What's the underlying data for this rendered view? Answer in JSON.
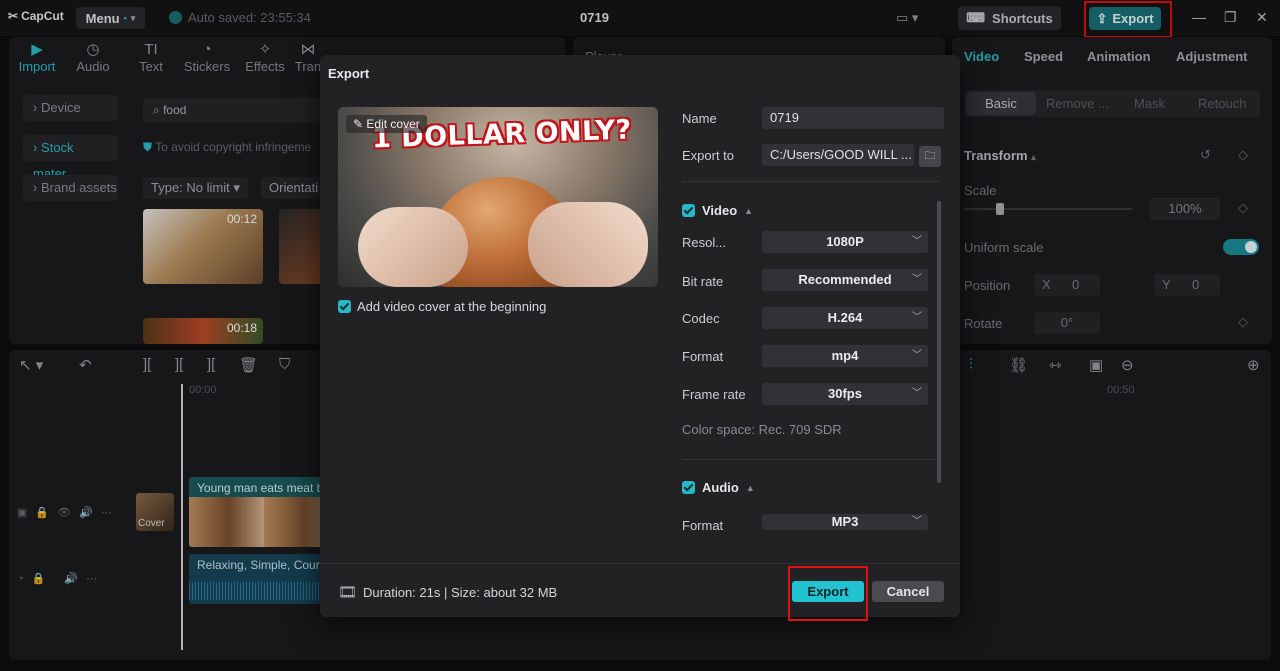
{
  "app": {
    "logo": "CapCut",
    "menu_label": "Menu",
    "autosave": "Auto saved: 23:55:34",
    "project_title": "0719",
    "shortcuts_label": "Shortcuts",
    "export_label": "Export"
  },
  "left_panel": {
    "tools": [
      "Import",
      "Audio",
      "Text",
      "Stickers",
      "Effects",
      "Tran"
    ],
    "side_items": [
      "Device",
      "Stock mater...",
      "Brand assets"
    ],
    "search_value": "food",
    "notice": "To avoid copyright infringeme",
    "filters": [
      "Type: No limit",
      "Orientati"
    ],
    "thumbs": [
      {
        "duration": "00:12"
      },
      {
        "duration": "00:18"
      }
    ]
  },
  "player": {
    "title": "Player"
  },
  "right_panel": {
    "tabs": [
      "Video",
      "Speed",
      "Animation",
      "Adjustment"
    ],
    "subtabs": [
      "Basic",
      "Remove ...",
      "Mask",
      "Retouch"
    ],
    "transform_label": "Transform",
    "scale_label": "Scale",
    "scale_value": "100%",
    "uniform_scale_label": "Uniform scale",
    "position_label": "Position",
    "pos_x_label": "X",
    "pos_x_value": "0",
    "pos_y_label": "Y",
    "pos_y_value": "0",
    "rotate_label": "Rotate",
    "rotate_value": "0°"
  },
  "timeline": {
    "time_start": "00:00",
    "time_mark": "00:50",
    "video_clip": "Young man eats meat bu",
    "audio_clip": "Relaxing, Simple, Country",
    "cover_label": "Cover"
  },
  "dialog": {
    "title": "Export",
    "edit_cover": "Edit cover",
    "cover_text": "1 DOLLAR ONLY?",
    "add_cover_label": "Add video cover at the beginning",
    "name_label": "Name",
    "name_value": "0719",
    "export_to_label": "Export to",
    "export_to_value": "C:/Users/GOOD WILL ...",
    "video_section": "Video",
    "resolution_label": "Resol...",
    "resolution_value": "1080P",
    "bitrate_label": "Bit rate",
    "bitrate_value": "Recommended",
    "codec_label": "Codec",
    "codec_value": "H.264",
    "format_label": "Format",
    "format_value": "mp4",
    "framerate_label": "Frame rate",
    "framerate_value": "30fps",
    "colorspace": "Color space: Rec. 709 SDR",
    "audio_section": "Audio",
    "audio_format_label": "Format",
    "audio_format_value": "MP3",
    "duration_size": "Duration: 21s | Size: about 32 MB",
    "export_button": "Export",
    "cancel_button": "Cancel"
  },
  "colors": {
    "accent": "#22c2d0",
    "highlight": "#e01010",
    "dialog_bg": "#222225"
  }
}
